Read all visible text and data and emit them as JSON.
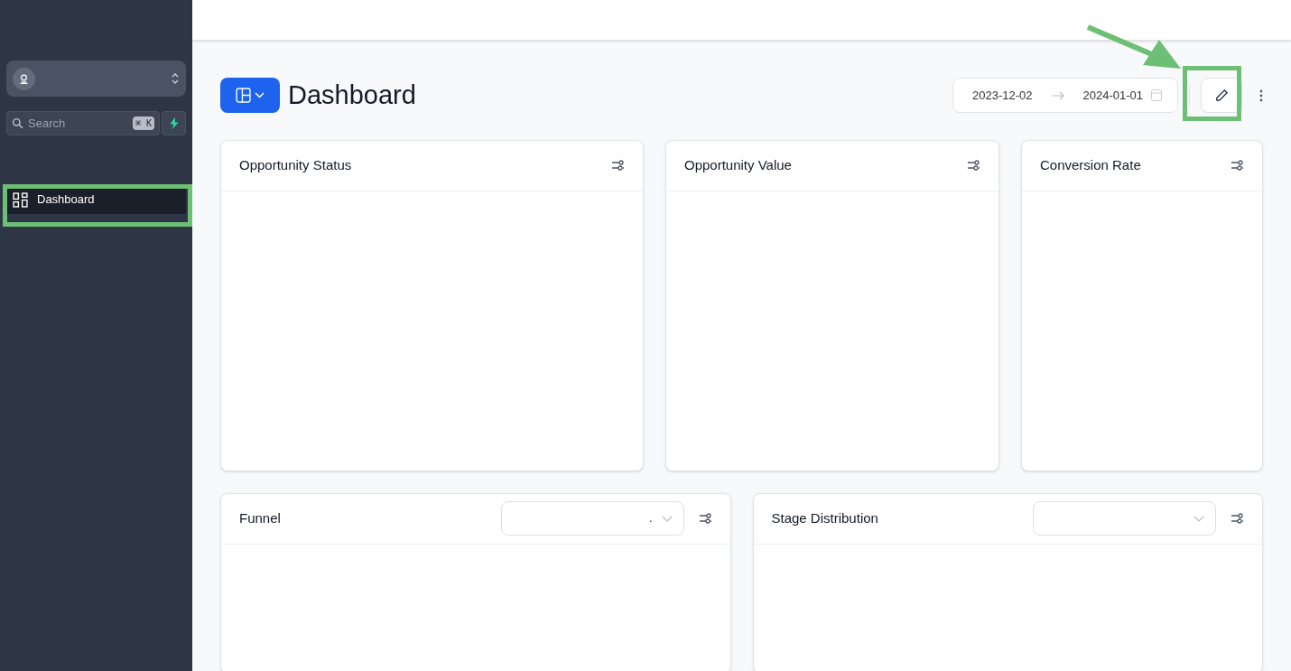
{
  "sidebar": {
    "search": {
      "placeholder": "Search",
      "shortcut": "⌘ K"
    },
    "items": [
      {
        "label": "Dashboard",
        "selected": true
      }
    ]
  },
  "header": {
    "title": "Dashboard",
    "date_range": {
      "start": "2023-12-02",
      "end": "2024-01-01"
    }
  },
  "top_cards": [
    {
      "title": "Opportunity Status"
    },
    {
      "title": "Opportunity Value"
    },
    {
      "title": "Conversion Rate"
    }
  ],
  "bottom_cards": [
    {
      "title": "Funnel",
      "kind": "select",
      "select_value": "."
    },
    {
      "title": "Stage Distribution",
      "kind": "select"
    }
  ]
}
